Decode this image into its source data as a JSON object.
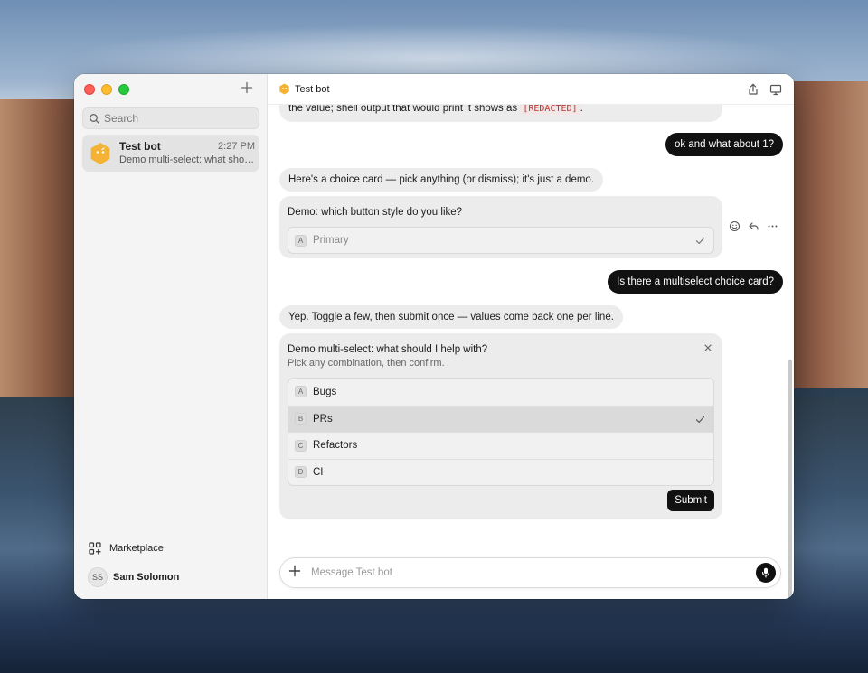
{
  "sidebar": {
    "new_chat_icon": "plus-icon",
    "search_placeholder": "Search",
    "conversation": {
      "title": "Test bot",
      "time": "2:27 PM",
      "preview": "Demo multi-select: what should I help with?"
    },
    "marketplace_label": "Marketplace",
    "user_initials": "SS",
    "user_name": "Sam Solomon"
  },
  "topbar": {
    "title": "Test bot",
    "share_icon": "share-icon",
    "display_icon": "monitor-icon"
  },
  "messages": {
    "m0_prefix": "the value; shell output that would print it shows as ",
    "m0_code": "[REDACTED]",
    "m0_suffix": ".",
    "m1_user": "ok and what about 1?",
    "m2_bot": "Here's a choice card — pick anything (or dismiss); it's just a demo.",
    "card1": {
      "title": "Demo: which button style do you like?",
      "option_key": "A",
      "option_label": "Primary"
    },
    "m3_user": "Is there a multiselect choice card?",
    "m4_bot": "Yep. Toggle a few, then submit once — values come back one per line.",
    "card2": {
      "title": "Demo multi-select: what should I help with?",
      "subtitle": "Pick any combination, then confirm.",
      "options": [
        {
          "key": "A",
          "label": "Bugs",
          "selected": false
        },
        {
          "key": "B",
          "label": "PRs",
          "selected": true
        },
        {
          "key": "C",
          "label": "Refactors",
          "selected": false
        },
        {
          "key": "D",
          "label": "CI",
          "selected": false
        }
      ],
      "submit_label": "Submit"
    }
  },
  "composer": {
    "placeholder": "Message Test bot"
  },
  "colors": {
    "accent_dark": "#111111",
    "bot_bubble": "#ececec",
    "avatar_orange": "#f5b335",
    "code_red": "#c2342f"
  }
}
